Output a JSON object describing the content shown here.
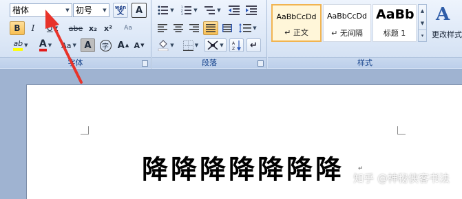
{
  "font_group": {
    "label": "字体",
    "font_name": "楷体",
    "font_size": "初号",
    "phonetic_label": "wén\n文",
    "char_border_label": "A",
    "bold": "B",
    "italic": "I",
    "underline": "U",
    "strikethrough": "abe",
    "subscript": "x₂",
    "superscript": "x²",
    "clear_format_label": "Aa",
    "highlight_label": "ab",
    "font_color_label": "A",
    "change_case_label": "Aa",
    "char_shading_label": "A",
    "enclose_char_label": "字",
    "grow_font_label": "A",
    "shrink_font_label": "A"
  },
  "paragraph_group": {
    "label": "段落"
  },
  "styles_group": {
    "label": "样式",
    "tiles": [
      {
        "sample": "AaBbCcDd",
        "name": "↵ 正文"
      },
      {
        "sample": "AaBbCcDd",
        "name": "↵ 无间隔"
      },
      {
        "sample": "AaBb",
        "name": "标题 1"
      }
    ],
    "change_styles_label": "更改样式"
  },
  "document": {
    "text": "降降降降降降降",
    "paragraph_mark": "↵"
  },
  "watermark": "知乎 @神秘侠客书法",
  "colors": {
    "highlight": "#ffff00",
    "font_color": "#e21b1b",
    "arrow": "#e8332a"
  }
}
